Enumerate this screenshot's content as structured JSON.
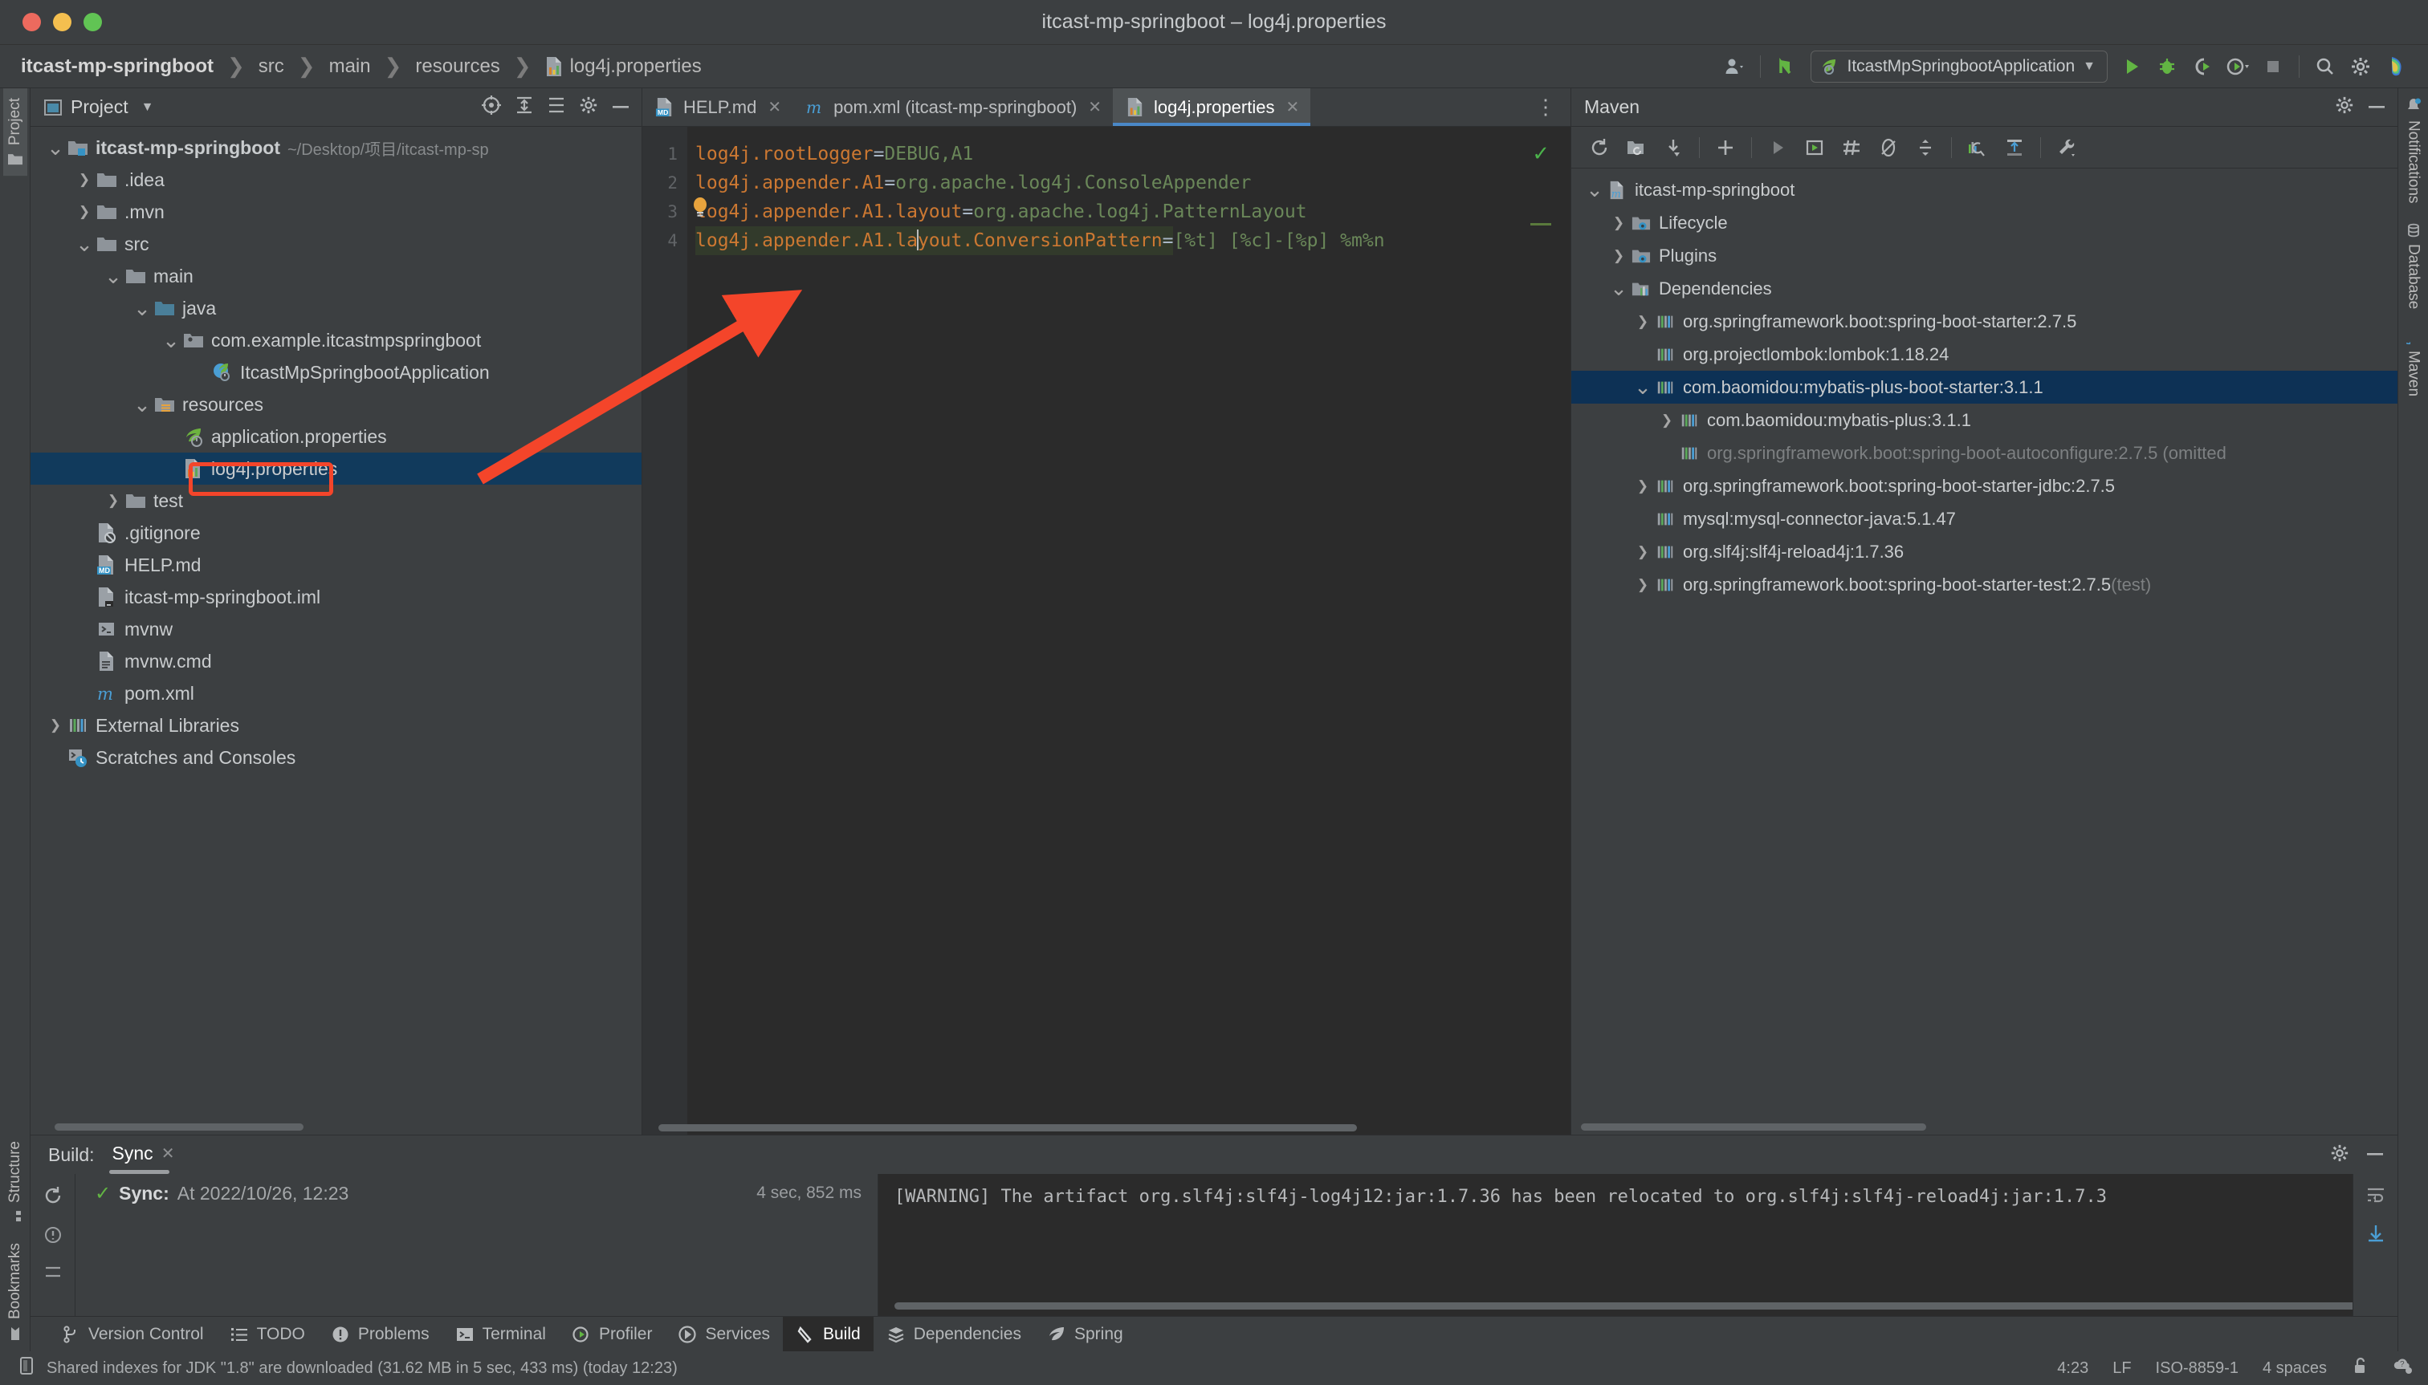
{
  "window": {
    "title": "itcast-mp-springboot – log4j.properties",
    "traffic_lights": [
      "close",
      "minimize",
      "zoom"
    ]
  },
  "navbar": {
    "breadcrumbs": [
      "itcast-mp-springboot",
      "src",
      "main",
      "resources",
      "log4j.properties"
    ],
    "run_configuration": "ItcastMpSpringbootApplication",
    "buttons": [
      "account-icon",
      "updates-icon",
      "run-icon",
      "debug-icon",
      "run-with-coverage-icon",
      "profile-icon",
      "stop-icon",
      "search-everywhere-icon",
      "settings-icon",
      "ai-assistant-icon"
    ]
  },
  "left_stripe": {
    "top": [
      {
        "label": "Project",
        "active": true
      }
    ],
    "bottom": [
      {
        "label": "Structure"
      },
      {
        "label": "Bookmarks"
      }
    ]
  },
  "right_stripe": {
    "items": [
      {
        "label": "Notifications"
      },
      {
        "label": "Database"
      },
      {
        "label": "Maven"
      }
    ]
  },
  "project_panel": {
    "title": "Project",
    "tree": [
      {
        "depth": 0,
        "twist": "v",
        "icon": "module-icon",
        "label": "itcast-mp-springboot",
        "bold": true,
        "path": "~/Desktop/项目/itcast-mp-sp"
      },
      {
        "depth": 1,
        "twist": ">",
        "icon": "folder-icon",
        "label": ".idea"
      },
      {
        "depth": 1,
        "twist": ">",
        "icon": "folder-icon",
        "label": ".mvn"
      },
      {
        "depth": 1,
        "twist": "v",
        "icon": "folder-icon",
        "label": "src"
      },
      {
        "depth": 2,
        "twist": "v",
        "icon": "folder-icon",
        "label": "main"
      },
      {
        "depth": 3,
        "twist": "v",
        "icon": "source-root-icon",
        "label": "java"
      },
      {
        "depth": 4,
        "twist": "v",
        "icon": "package-icon",
        "label": "com.example.itcastmpspringboot"
      },
      {
        "depth": 5,
        "twist": "",
        "icon": "spring-class-icon",
        "label": "ItcastMpSpringbootApplication"
      },
      {
        "depth": 3,
        "twist": "v",
        "icon": "resource-root-icon",
        "label": "resources"
      },
      {
        "depth": 4,
        "twist": "",
        "icon": "spring-properties-icon",
        "label": "application.properties"
      },
      {
        "depth": 4,
        "twist": "",
        "icon": "properties-icon",
        "label": "log4j.properties",
        "selected": true,
        "annotated": true
      },
      {
        "depth": 2,
        "twist": ">",
        "icon": "folder-icon",
        "label": "test"
      },
      {
        "depth": 1,
        "twist": "",
        "icon": "gitignore-icon",
        "label": ".gitignore"
      },
      {
        "depth": 1,
        "twist": "",
        "icon": "markdown-icon",
        "label": "HELP.md"
      },
      {
        "depth": 1,
        "twist": "",
        "icon": "iml-icon",
        "label": "itcast-mp-springboot.iml"
      },
      {
        "depth": 1,
        "twist": "",
        "icon": "script-icon",
        "label": "mvnw"
      },
      {
        "depth": 1,
        "twist": "",
        "icon": "cmd-icon",
        "label": "mvnw.cmd"
      },
      {
        "depth": 1,
        "twist": "",
        "icon": "maven-icon",
        "label": "pom.xml"
      },
      {
        "depth": 0,
        "twist": ">",
        "icon": "library-icon",
        "label": "External Libraries"
      },
      {
        "depth": 0,
        "twist": "",
        "icon": "scratches-icon",
        "label": "Scratches and Consoles"
      }
    ]
  },
  "editor": {
    "tabs": [
      {
        "label": "HELP.md",
        "icon": "markdown-icon",
        "active": false
      },
      {
        "label": "pom.xml (itcast-mp-springboot)",
        "icon": "maven-icon",
        "active": false
      },
      {
        "label": "log4j.properties",
        "icon": "properties-icon",
        "active": true
      }
    ],
    "lines": [
      {
        "num": "1",
        "key": "log4j.rootLogger",
        "eq": "=",
        "value": "DEBUG,A1"
      },
      {
        "num": "2",
        "key": "log4j.appender.A1",
        "eq": "=",
        "value": "org.apache.log4j.ConsoleAppender"
      },
      {
        "num": "3",
        "key": "log4j.appender.A1.layout",
        "eq": "=",
        "value": "org.apache.log4j.PatternLayout"
      },
      {
        "num": "4",
        "key": "log4j.appender.A1.layout.ConversionPattern",
        "eq": "=",
        "value": "[%t] [%c]-[%p] %m%n",
        "current": true
      }
    ],
    "inspection_status": "ok-checkmark"
  },
  "maven_panel": {
    "title": "Maven",
    "tree": [
      {
        "depth": 0,
        "twist": "v",
        "icon": "maven-module-icon",
        "label": "itcast-mp-springboot"
      },
      {
        "depth": 1,
        "twist": ">",
        "icon": "lifecycle-icon",
        "label": "Lifecycle"
      },
      {
        "depth": 1,
        "twist": ">",
        "icon": "plugins-icon",
        "label": "Plugins"
      },
      {
        "depth": 1,
        "twist": "v",
        "icon": "dependencies-icon",
        "label": "Dependencies"
      },
      {
        "depth": 2,
        "twist": ">",
        "icon": "library-icon",
        "label": "org.springframework.boot:spring-boot-starter:2.7.5"
      },
      {
        "depth": 2,
        "twist": "",
        "icon": "library-icon",
        "label": "org.projectlombok:lombok:1.18.24"
      },
      {
        "depth": 2,
        "twist": "v",
        "icon": "library-icon",
        "label": "com.baomidou:mybatis-plus-boot-starter:3.1.1",
        "selected": true
      },
      {
        "depth": 3,
        "twist": ">",
        "icon": "library-icon",
        "label": "com.baomidou:mybatis-plus:3.1.1"
      },
      {
        "depth": 3,
        "twist": "",
        "icon": "library-icon",
        "label": "org.springframework.boot:spring-boot-autoconfigure:2.7.5 (omitted",
        "omitted": true
      },
      {
        "depth": 2,
        "twist": ">",
        "icon": "library-icon",
        "label": "org.springframework.boot:spring-boot-starter-jdbc:2.7.5"
      },
      {
        "depth": 2,
        "twist": "",
        "icon": "library-icon",
        "label": "mysql:mysql-connector-java:5.1.47"
      },
      {
        "depth": 2,
        "twist": ">",
        "icon": "library-icon",
        "label": "org.slf4j:slf4j-reload4j:1.7.36"
      },
      {
        "depth": 2,
        "twist": ">",
        "icon": "library-icon",
        "label": "org.springframework.boot:spring-boot-starter-test:2.7.5",
        "suffix": " (test)"
      }
    ]
  },
  "build_panel": {
    "label": "Build:",
    "tab": "Sync",
    "sync_status": "Sync:",
    "sync_time": "At 2022/10/26, 12:23",
    "duration": "4 sec, 852 ms",
    "console": "[WARNING] The artifact org.slf4j:slf4j-log4j12:jar:1.7.36 has been relocated to org.slf4j:slf4j-reload4j:jar:1.7.3"
  },
  "bottom_tabs": [
    {
      "label": "Version Control",
      "icon": "branch-icon",
      "active": false
    },
    {
      "label": "TODO",
      "icon": "todo-icon",
      "active": false
    },
    {
      "label": "Problems",
      "icon": "problems-icon",
      "active": false
    },
    {
      "label": "Terminal",
      "icon": "terminal-icon",
      "active": false
    },
    {
      "label": "Profiler",
      "icon": "profiler-icon",
      "active": false
    },
    {
      "label": "Services",
      "icon": "services-icon",
      "active": false
    },
    {
      "label": "Build",
      "icon": "build-icon",
      "active": true
    },
    {
      "label": "Dependencies",
      "icon": "dependencies-icon",
      "active": false
    },
    {
      "label": "Spring",
      "icon": "spring-icon",
      "active": false
    }
  ],
  "statusbar": {
    "message": "Shared indexes for JDK \"1.8\" are downloaded (31.62 MB in 5 sec, 433 ms) (today 12:23)",
    "caret_position": "4:23",
    "line_separator": "LF",
    "encoding": "ISO-8859-1",
    "indent": "4 spaces",
    "lock_icon": "unlocked-icon",
    "help_icon": "help-icon"
  },
  "colors": {
    "accent_blue": "#4a88c7",
    "selection_blue": "#113a5c",
    "annotation_red": "#f4452a",
    "success_green": "#62b543",
    "key_orange": "#cc7832",
    "value_green": "#6a8759"
  }
}
